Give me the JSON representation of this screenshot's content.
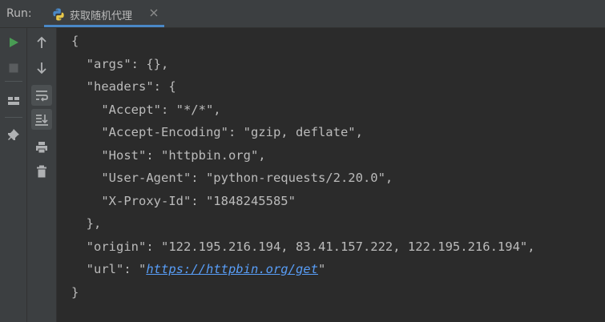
{
  "toolwindow": {
    "run_label": "Run:",
    "tab": {
      "label": "获取随机代理",
      "icon": "python-icon",
      "close_icon": "close-icon"
    }
  },
  "left_toolbar": [
    {
      "icon": "run-icon",
      "color": "#499c54"
    },
    {
      "icon": "stop-icon",
      "color": "#5a5d5f"
    },
    {
      "icon": "layout-icon",
      "color": "#afb1b3"
    },
    {
      "icon": "pin-icon",
      "color": "#afb1b3"
    }
  ],
  "right_toolbar": [
    {
      "icon": "arrow-up-icon"
    },
    {
      "icon": "arrow-down-icon"
    },
    {
      "icon": "soft-wrap-icon",
      "active": true
    },
    {
      "icon": "scroll-to-end-icon",
      "active": true
    },
    {
      "icon": "print-icon"
    },
    {
      "icon": "trash-icon"
    }
  ],
  "console": {
    "lines": [
      "{",
      "  \"args\": {},",
      "  \"headers\": {",
      "    \"Accept\": \"*/*\",",
      "    \"Accept-Encoding\": \"gzip, deflate\",",
      "    \"Host\": \"httpbin.org\",",
      "    \"User-Agent\": \"python-requests/2.20.0\",",
      "    \"X-Proxy-Id\": \"1848245585\"",
      "  },",
      "  \"origin\": \"122.195.216.194, 83.41.157.222, 122.195.216.194\",",
      "  \"url\": \"",
      "}"
    ],
    "url_link": "https://httpbin.org/get",
    "url_suffix": "\"",
    "text_color": "#bbbbbb",
    "link_color": "#589df6"
  },
  "colors": {
    "background": "#2b2b2b",
    "panel": "#3c3f41",
    "tab_underline": "#4a88c7"
  }
}
